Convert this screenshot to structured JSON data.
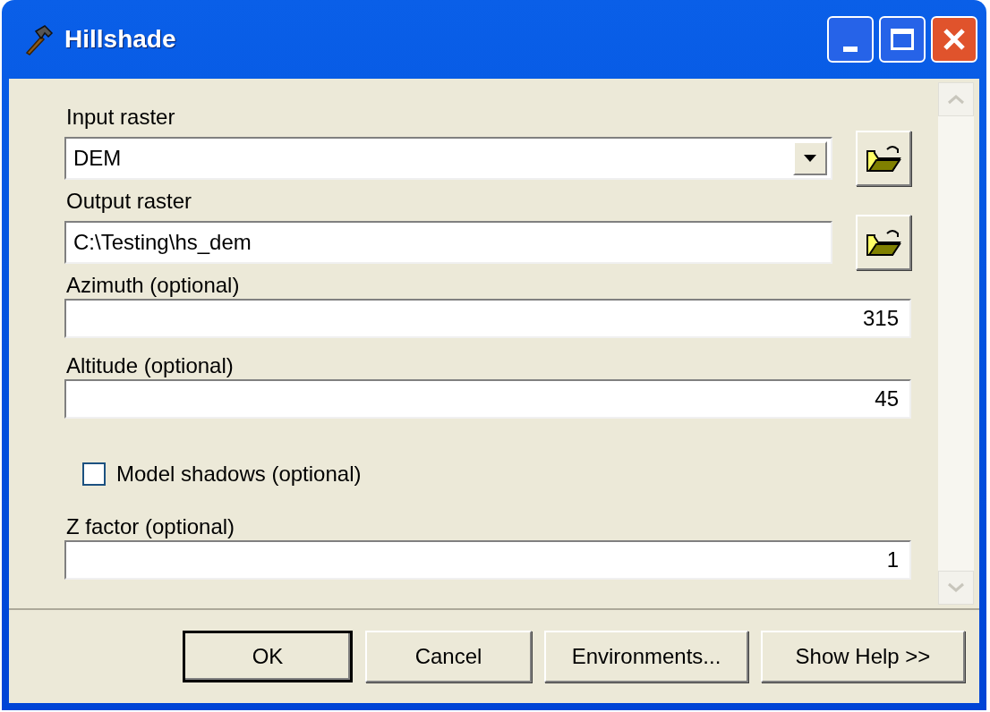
{
  "window": {
    "title": "Hillshade"
  },
  "fields": [
    {
      "kind": "combo",
      "label": "Input raster",
      "value": "DEM",
      "browse": true
    },
    {
      "kind": "text",
      "label": "Output raster",
      "value": "C:\\Testing\\hs_dem",
      "browse": true
    },
    {
      "kind": "number",
      "label": "Azimuth (optional)",
      "value": "315",
      "browse": false
    },
    {
      "kind": "number",
      "label": "Altitude (optional)",
      "value": "45",
      "browse": false
    },
    {
      "kind": "checkbox",
      "label": "Model shadows (optional)",
      "checked": false
    },
    {
      "kind": "number",
      "label": "Z factor (optional)",
      "value": "1",
      "browse": false
    }
  ],
  "buttons": [
    {
      "label": "OK",
      "selected": true
    },
    {
      "label": "Cancel",
      "selected": false
    },
    {
      "label": "Environments...",
      "selected": false
    },
    {
      "label": "Show Help >>",
      "selected": false
    }
  ]
}
